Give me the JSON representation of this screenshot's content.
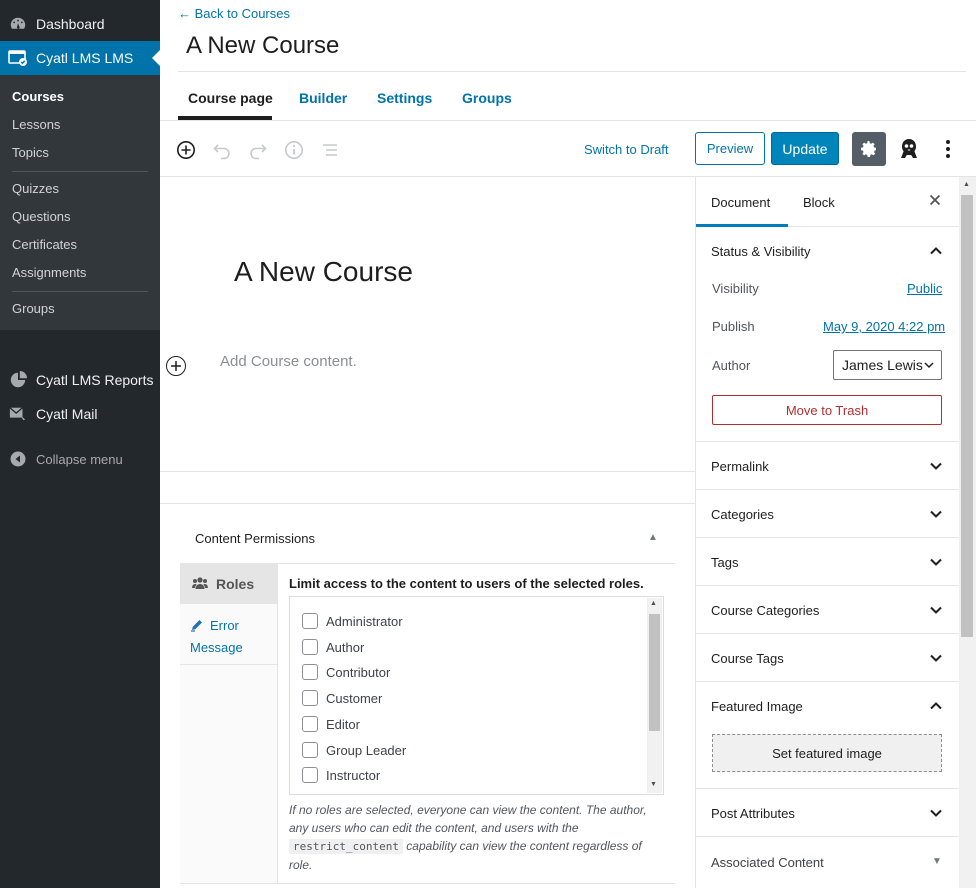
{
  "admin_menu": {
    "dashboard": "Dashboard",
    "lms": "Cyatl LMS LMS",
    "submenu": [
      "Courses",
      "Lessons",
      "Topics",
      "Quizzes",
      "Questions",
      "Certificates",
      "Assignments",
      "Groups"
    ],
    "reports": "Cyatl LMS Reports",
    "mail": "Cyatl Mail",
    "collapse": "Collapse menu"
  },
  "header": {
    "back": "← Back to Courses",
    "title": "A New Course",
    "tabs": [
      "Course page",
      "Builder",
      "Settings",
      "Groups"
    ]
  },
  "toolbar": {
    "switch_draft": "Switch to Draft",
    "preview": "Preview",
    "update": "Update"
  },
  "editor": {
    "post_title": "A New Course",
    "placeholder": "Add Course content."
  },
  "content_permissions": {
    "title": "Content Permissions",
    "tab_roles": "Roles",
    "tab_error": "Error Message",
    "description": "Limit access to the content to users of the selected roles.",
    "roles": [
      "Administrator",
      "Author",
      "Contributor",
      "Customer",
      "Editor",
      "Group Leader",
      "Instructor"
    ],
    "note_before": "If no roles are selected, everyone can view the content. The author, any users who can edit the content, and users with the ",
    "note_code": "restrict_content",
    "note_after": " capability can view the content regardless of role."
  },
  "sidebar": {
    "tab_document": "Document",
    "tab_block": "Block",
    "status_title": "Status & Visibility",
    "visibility_label": "Visibility",
    "visibility_value": "Public",
    "publish_label": "Publish",
    "publish_value": "May 9, 2020 4:22 pm",
    "author_label": "Author",
    "author_value": "James Lewis",
    "trash": "Move to Trash",
    "panels": [
      "Permalink",
      "Categories",
      "Tags",
      "Course Categories",
      "Course Tags"
    ],
    "featured_title": "Featured Image",
    "featured_button": "Set featured image",
    "post_attributes": "Post Attributes",
    "associated": "Associated Content"
  },
  "colors": {
    "admin_bg": "#23282d",
    "accent": "#0073aa",
    "update_bg": "#0085ba",
    "danger": "#b32d2e"
  }
}
